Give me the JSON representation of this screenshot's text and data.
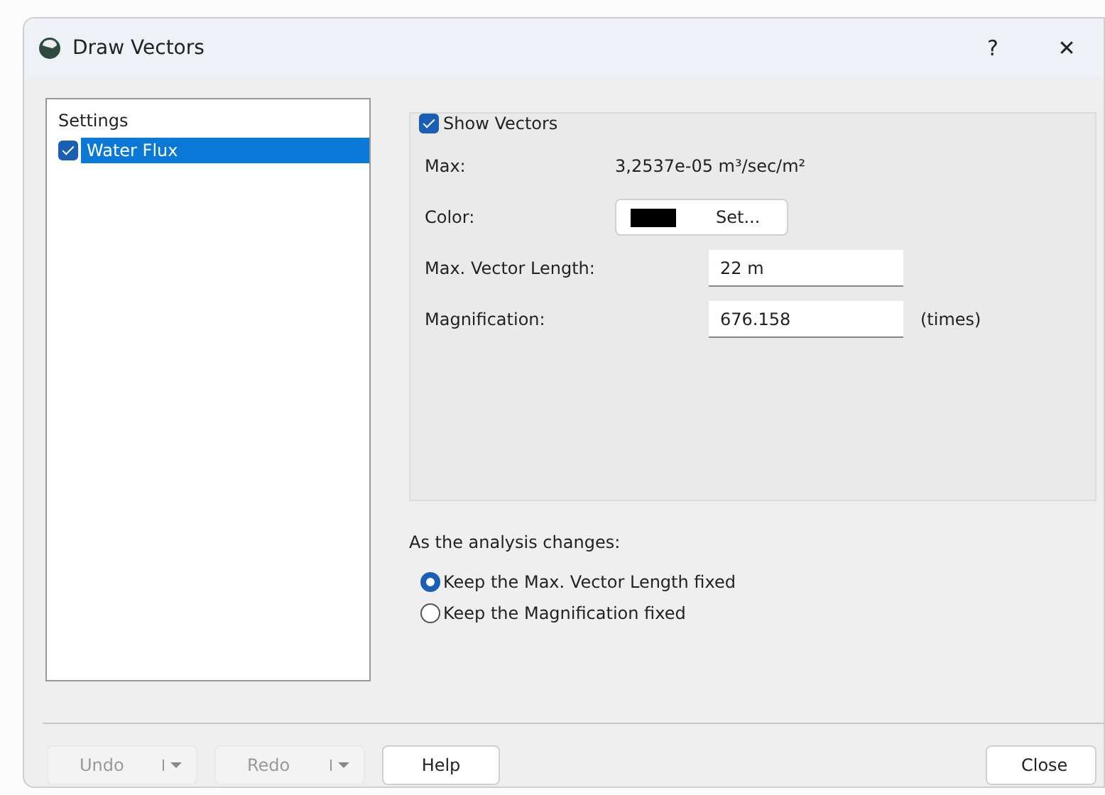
{
  "window": {
    "title": "Draw Vectors",
    "help": "?",
    "close": "✕"
  },
  "settings_list": {
    "heading": "Settings",
    "items": [
      {
        "label": "Water Flux",
        "checked": true,
        "selected": true
      }
    ]
  },
  "show_vectors": {
    "label": "Show Vectors",
    "checked": true
  },
  "fields": [
    {
      "kind": "text",
      "label": "Max:",
      "value": "3,2537e-05 m³/sec/m²"
    },
    {
      "kind": "color",
      "label": "Color:",
      "color": "#000000",
      "button": "Set..."
    },
    {
      "kind": "input",
      "label": "Max. Vector Length:",
      "value": "22 m"
    },
    {
      "kind": "input",
      "label": "Magnification:",
      "value": "676.158",
      "unit": "(times)"
    }
  ],
  "analysis": {
    "label": "As the analysis changes:",
    "options": [
      {
        "label": "Keep the Max. Vector Length fixed",
        "selected": true
      },
      {
        "label": "Keep the Magnification fixed",
        "selected": false
      }
    ]
  },
  "buttons": [
    {
      "kind": "split",
      "label": "Undo",
      "disabled": true
    },
    {
      "kind": "split",
      "label": "Redo",
      "disabled": true
    },
    {
      "kind": "plain",
      "label": "Help",
      "disabled": false
    },
    {
      "kind": "close",
      "label": "Close",
      "disabled": false
    }
  ]
}
